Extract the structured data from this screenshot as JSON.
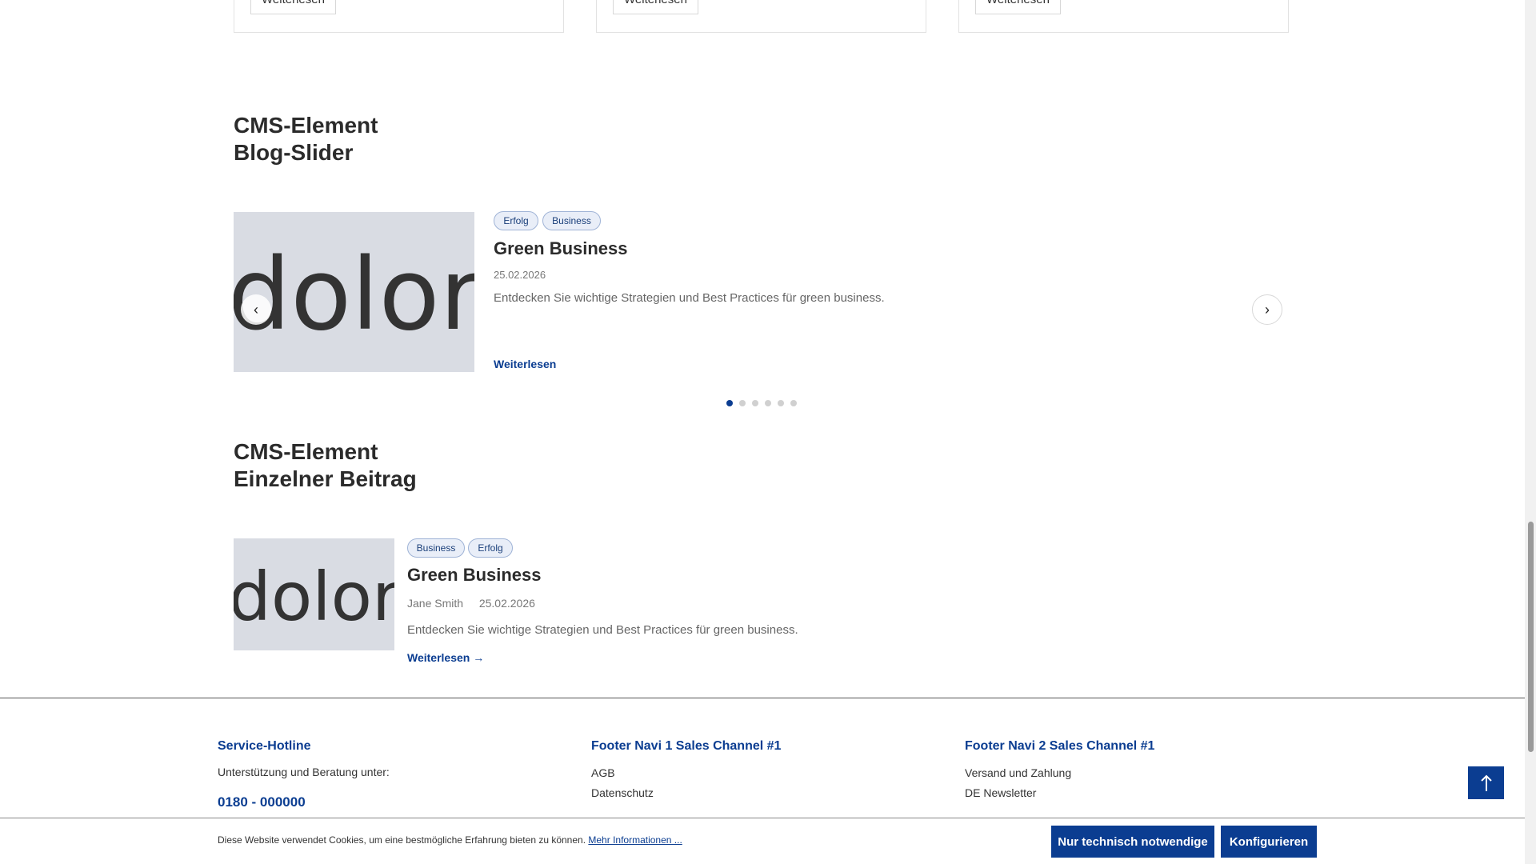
{
  "top_cards": [
    {
      "button_label": "Weiterlesen"
    },
    {
      "button_label": "Weiterlesen"
    },
    {
      "button_label": "Weiterlesen"
    }
  ],
  "blog_slider": {
    "title_line1": "CMS-Element",
    "title_line2": "Blog-Slider",
    "image_text": "dolor",
    "tags": [
      "Erfolg",
      "Business"
    ],
    "post_title": "Green Business",
    "date": "25.02.2026",
    "excerpt": "Entdecken Sie wichtige Strategien und Best Practices für green business.",
    "read_more": "Weiterlesen",
    "prev_icon": "‹",
    "next_icon": "›",
    "dot_count": 6,
    "active_dot": 1
  },
  "single_post": {
    "title_line1": "CMS-Element",
    "title_line2": "Einzelner Beitrag",
    "image_text": "dolor",
    "tags": [
      "Business",
      "Erfolg"
    ],
    "post_title": "Green Business",
    "author": "Jane Smith",
    "date": "25.02.2026",
    "excerpt": "Entdecken Sie wichtige Strategien und Best Practices für green business.",
    "read_more": "Weiterlesen →"
  },
  "footer": {
    "col1": {
      "heading": "Service-Hotline",
      "text": "Unterstützung und Beratung unter:",
      "phone": "0180 - 000000"
    },
    "col2": {
      "heading": "Footer Navi 1 Sales Channel #1",
      "links": [
        "AGB",
        "Datenschutz"
      ]
    },
    "col3": {
      "heading": "Footer Navi 2 Sales Channel #1",
      "links": [
        "Versand und Zahlung",
        "DE Newsletter"
      ]
    }
  },
  "scroll_top_icon": "arrow-up-icon",
  "cookie": {
    "text": "Diese Website verwendet Cookies, um eine bestmögliche Erfahrung bieten zu können.",
    "link": "Mehr Informationen ...",
    "btn_necessary": "Nur technisch notwendige",
    "btn_configure": "Konfigurieren"
  },
  "colors": {
    "accent": "#0b3d91",
    "tag_bg": "#e9eef8",
    "image_bg": "#d9dce3"
  }
}
